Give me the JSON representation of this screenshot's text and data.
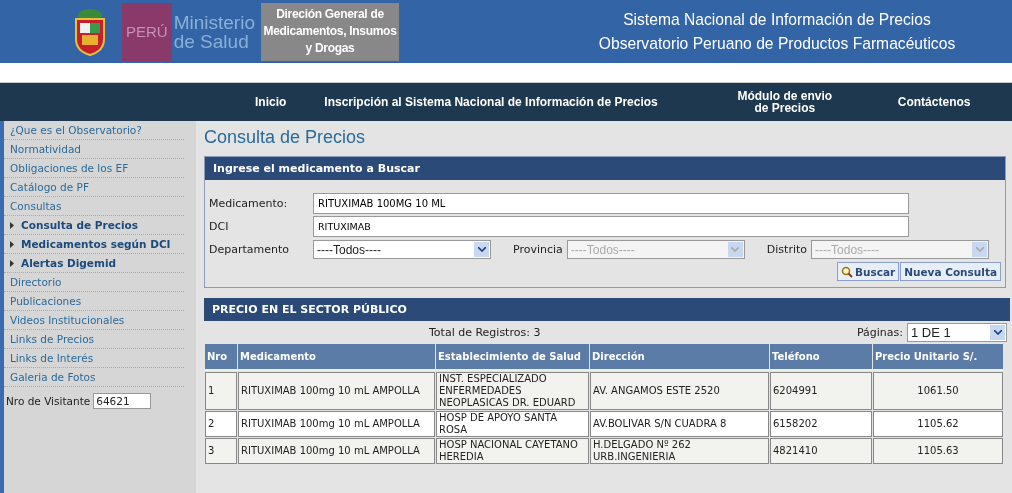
{
  "header": {
    "country": "PERÚ",
    "ministry": [
      "Ministerio",
      "de Salud"
    ],
    "direction": "Direción General de Medicamentos, Insumos y Drogas",
    "titles": [
      "Sistema Nacional de Información de Precios",
      "Observatorio Peruano de Productos Farmacéuticos"
    ]
  },
  "nav": [
    "Inicio",
    "Inscripción al Sistema Nacional de Información de Precios",
    "Módulo de envio de Precios",
    "Contáctenos"
  ],
  "sidebar": {
    "items": [
      {
        "label": "¿Que es el Observatorio?",
        "kind": "item"
      },
      {
        "label": "Normatividad",
        "kind": "item"
      },
      {
        "label": "Obligaciones de los EF",
        "kind": "item"
      },
      {
        "label": "Catálogo de PF",
        "kind": "item"
      },
      {
        "label": "Consultas",
        "kind": "item"
      },
      {
        "label": "Consulta de Precios",
        "kind": "subitem"
      },
      {
        "label": "Medicamentos según DCI",
        "kind": "subitem"
      },
      {
        "label": "Alertas Digemid",
        "kind": "subitem"
      },
      {
        "label": "Directorio",
        "kind": "item"
      },
      {
        "label": "Publicaciones",
        "kind": "item"
      },
      {
        "label": "Videos Institucionales",
        "kind": "item"
      },
      {
        "label": "Links de Precios",
        "kind": "item"
      },
      {
        "label": "Links de Interés",
        "kind": "item"
      },
      {
        "label": "Galeria de Fotos",
        "kind": "item"
      }
    ],
    "visitor_label": "Nro de Visitante",
    "visitor_count": "64621"
  },
  "page_title": "Consulta de Precios",
  "search": {
    "title": "Ingrese el medicamento a Buscar",
    "medicamento": {
      "label": "Medicamento:",
      "value": "RITUXIMAB 100MG 10 ML"
    },
    "dci": {
      "label": "DCI",
      "value": "RITUXIMAB"
    },
    "selects": [
      {
        "label": "Departamento",
        "value": "----Todos----",
        "disabled": false
      },
      {
        "label": "Provincia",
        "value": "----Todos----",
        "disabled": true
      },
      {
        "label": "Distrito",
        "value": "----Todos----",
        "disabled": true
      }
    ],
    "buttons": [
      "Buscar",
      "Nueva Consulta"
    ]
  },
  "results": {
    "title": "PRECIO EN EL SECTOR PÚBLICO",
    "total": "Total de Registros: 3",
    "pages_label": "Páginas:",
    "pages_value": "1 DE 1",
    "columns": [
      "Nro",
      "Medicamento",
      "Establecimiento de Salud",
      "Dirección",
      "Teléfono",
      "Precio Unitario S/."
    ],
    "rows": [
      [
        "1",
        "RITUXIMAB 100mg 10 mL AMPOLLA",
        "INST. ESPECIALIZADO ENFERMEDADES NEOPLASICAS DR. EDUARD",
        "AV. ANGAMOS ESTE 2520",
        "6204991",
        "1061.50"
      ],
      [
        "2",
        "RITUXIMAB 100mg 10 mL AMPOLLA",
        "HOSP DE APOYO SANTA ROSA",
        "AV.BOLIVAR S/N CUADRA 8",
        "6158202",
        "1105.62"
      ],
      [
        "3",
        "RITUXIMAB 100mg 10 mL AMPOLLA",
        "HOSP NACIONAL CAYETANO HEREDIA",
        "H.DELGADO Nº 262 URB.INGENIERIA",
        "4821410",
        "1105.63"
      ]
    ]
  }
}
